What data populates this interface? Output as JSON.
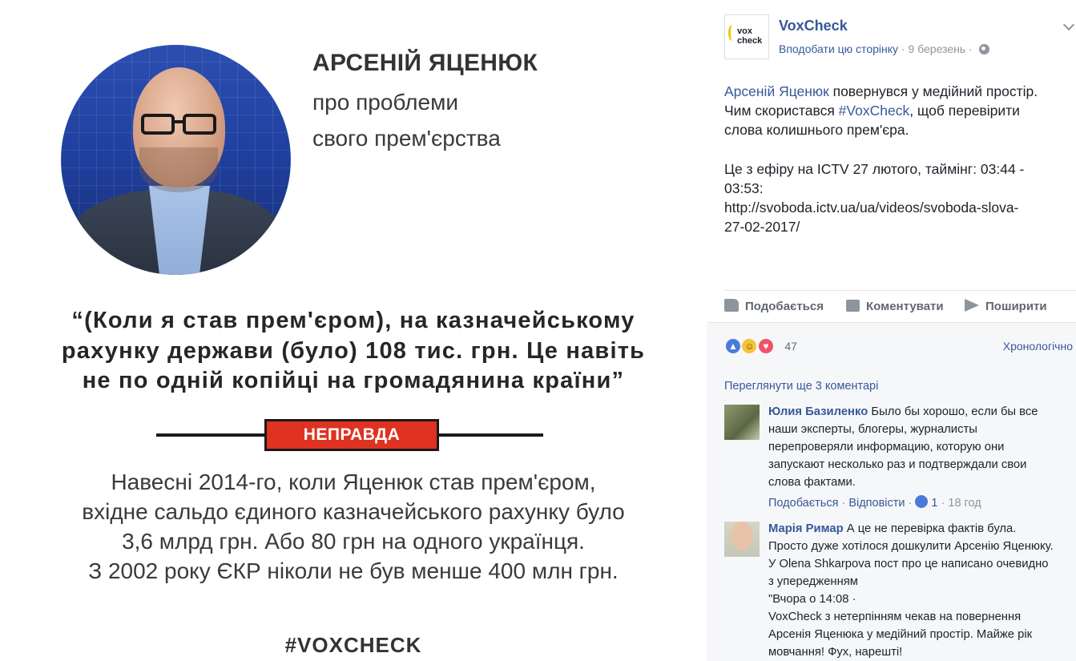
{
  "infographic": {
    "name": "АРСЕНІЙ ЯЦЕНЮК",
    "subtitle_lines": [
      "про проблеми",
      "свого прем'єрства"
    ],
    "quote_lines": [
      "“(Коли я став прем'єром), на казначейському",
      "рахунку держави (було) 108 тис. грн. Це навіть",
      "не по одній копійці на громадянина країни”"
    ],
    "verdict": "НЕПРАВДА",
    "verdict_color": "#e03221",
    "fact_lines": [
      "Навесні 2014-го, коли Яценюк став прем'єром,",
      "вхідне сальдо єдиного казначейського рахунку було",
      "3,6 млрд грн. Або 80 грн на одного українця.",
      "З 2002 року ЄКР ніколи не був менше 400 млн грн."
    ],
    "hashtag": "#VOXCHECK"
  },
  "post": {
    "avatar_logo_text": "vox check",
    "page_name": "VoxCheck",
    "like_page": "Вподобати цю сторінку",
    "separator": "·",
    "date": "9 березень",
    "text": {
      "line1_link": "Арсеній Яценюк",
      "line1_rest": " повернувся у медійний простір.",
      "line2_pre": "Чим скористався ",
      "line2_link": "#VoxCheck",
      "line2_post": ", щоб перевірити",
      "line3": "слова колишнього прем'єра.",
      "line4": "Це з ефіру на ICTV 27 лютого, таймінг: 03:44 -",
      "line5": "03:53:",
      "url_line1": "http://svoboda.ictv.ua/ua/videos/svoboda-slova-",
      "url_line2": "27-02-2017/"
    },
    "actions": {
      "like": "Подобається",
      "comment": "Коментувати",
      "share": "Поширити"
    },
    "reactions": {
      "icons": [
        "like-icon",
        "haha-icon",
        "love-icon"
      ],
      "count": "47"
    },
    "sort_label": "Хронологічно",
    "more_comments": "Переглянути ще 3 коментарі"
  },
  "comments": [
    {
      "author": "Юлия Базиленко",
      "lines": [
        " Было бы хорошо, если бы все",
        "наши эксперты, блогеры, журналисты",
        "перепроверяли информацию, которую они",
        "запускают несколько раз и подтверждали свои",
        "слова фактами."
      ],
      "like_label": "Подобається",
      "reply_label": "Відповісти",
      "likes": "1",
      "age": "18 год"
    },
    {
      "author": "Марія Римар",
      "lines": [
        " А це не перевірка фактів була.",
        "Просто дуже хотілося дошкулити Арсенію Яценюку.",
        "У Olena Shkarpova пост про це написано очевидно",
        "з упередженням",
        "\"Вчора о 14:08 ·",
        "VoxCheck з нетерпінням чекав на повернення",
        "Арсенія Яценюка у медійний простір. Майже рік",
        "мовчання! Фух, нарешті!"
      ]
    }
  ],
  "colors": {
    "link": "#365899",
    "muted": "#90949c",
    "panel_bg": "#f6f7f9"
  }
}
